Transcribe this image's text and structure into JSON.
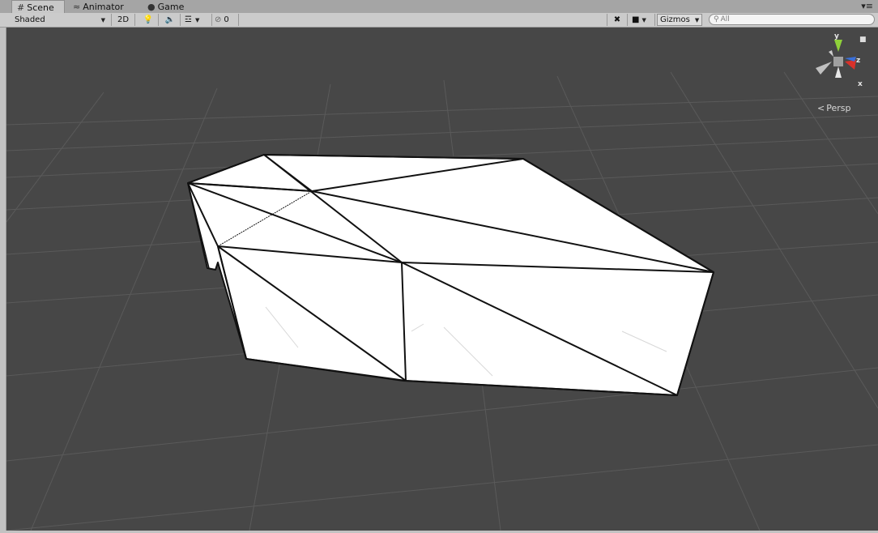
{
  "tabs": [
    {
      "label": "Scene",
      "icon": "grid-icon"
    },
    {
      "label": "Animator",
      "icon": "animator-icon"
    },
    {
      "label": "Game",
      "icon": "game-icon"
    }
  ],
  "toolbar": {
    "shading_mode": "Shaded",
    "mode_2d": "2D",
    "hidden_count": "0",
    "gizmos_label": "Gizmos",
    "search_placeholder": "All"
  },
  "viewport": {
    "projection_label": "Persp",
    "axis_y": "y",
    "axis_z": "z",
    "axis_x": "x"
  },
  "colors": {
    "background": "#474747",
    "mesh": "#ffffff",
    "axis_x": "#d8312a",
    "axis_y": "#8fd13a",
    "axis_z": "#3a6fd8"
  }
}
